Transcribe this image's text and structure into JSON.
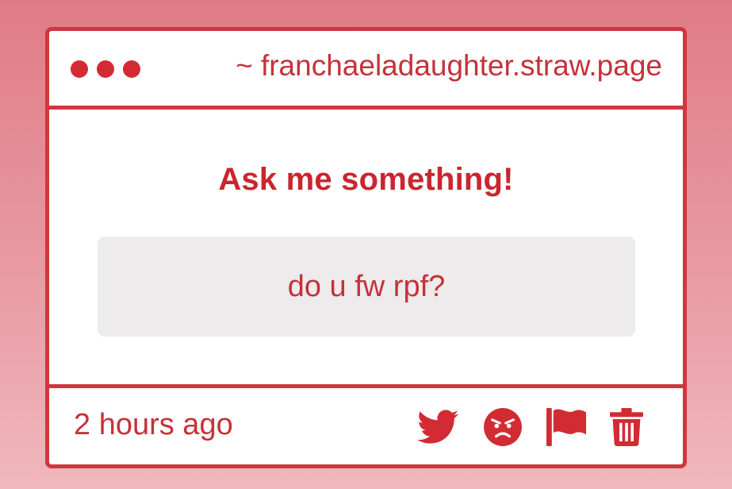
{
  "window": {
    "url": "~ franchaeladaughter.straw.page",
    "controls": [
      "dot",
      "dot",
      "dot"
    ]
  },
  "main": {
    "heading": "Ask me something!",
    "question": "do u fw rpf?"
  },
  "footer": {
    "timestamp": "2 hours ago",
    "actions": [
      {
        "name": "twitter-icon"
      },
      {
        "name": "angry-face-icon"
      },
      {
        "name": "flag-icon"
      },
      {
        "name": "trash-icon"
      }
    ]
  },
  "colors": {
    "accent": "#d0373f",
    "text": "#c6313a",
    "question_bg": "#edebec",
    "background_top": "#e07c86",
    "background_bottom": "#f0b8bd"
  }
}
